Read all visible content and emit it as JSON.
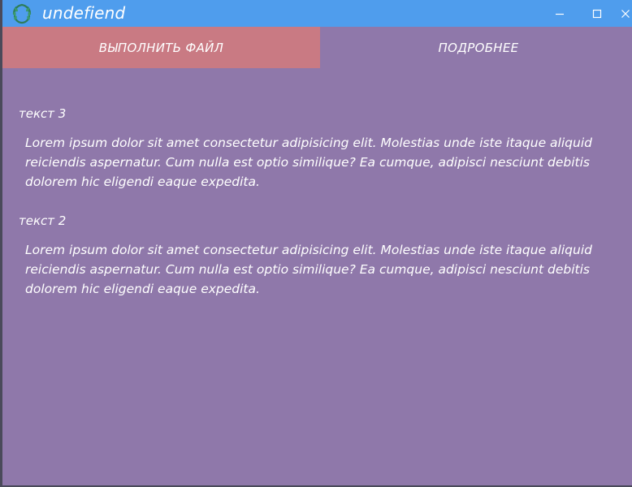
{
  "window": {
    "title": "undefiend",
    "controls": {
      "minimize_icon": "minimize-icon",
      "maximize_icon": "maximize-icon",
      "close_icon": "close-icon"
    }
  },
  "tabs": [
    {
      "label": "ВЫПОЛНИТЬ ФАЙЛ",
      "active": true
    },
    {
      "label": "ПОДРОБНЕЕ",
      "active": false
    }
  ],
  "sections": [
    {
      "title": "текст 3",
      "body": "Lorem ipsum dolor sit amet consectetur adipisicing elit. Molestias unde iste itaque aliquid reiciendis aspernatur. Cum nulla est optio similique? Ea cumque, adipisci nesciunt debitis dolorem hic eligendi eaque expedita."
    },
    {
      "title": "текст 2",
      "body": "Lorem ipsum dolor sit amet consectetur adipisicing elit. Molestias unde iste itaque aliquid reiciendis aspernatur. Cum nulla est optio similique? Ea cumque, adipisci nesciunt debitis dolorem hic eligendi eaque expedita."
    }
  ],
  "colors": {
    "titlebar": "#4f9ded",
    "background": "#8f78aa",
    "active_tab": "#c97a83",
    "text": "#ffffff",
    "logo": "#2e7d5b"
  }
}
